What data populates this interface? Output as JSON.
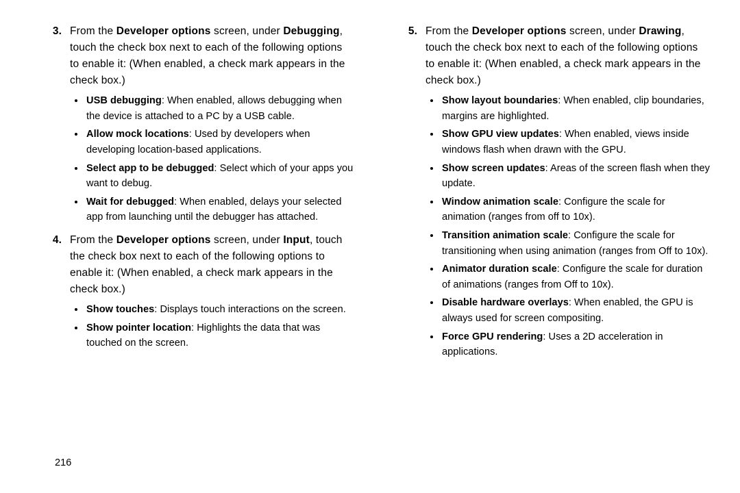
{
  "page_number": "216",
  "left": {
    "step3": {
      "num": "3.",
      "pre": "From the ",
      "b1": "Developer options",
      "mid": " screen, under ",
      "b2": "Debugging",
      "post": ", touch the check box next to each of the following options to enable it: (When enabled, a check mark appears in the check box.)",
      "items": [
        {
          "b": "USB debugging",
          "t": ": When enabled, allows debugging when the device is attached to a PC by a USB cable."
        },
        {
          "b": "Allow mock locations",
          "t": ": Used by developers when developing location-based applications."
        },
        {
          "b": "Select app to be debugged",
          "t": ": Select which of your apps you want to debug."
        },
        {
          "b": "Wait for debugged",
          "t": ": When enabled, delays your selected app from launching until the debugger has attached."
        }
      ]
    },
    "step4": {
      "num": "4.",
      "pre": "From the ",
      "b1": "Developer options",
      "mid": " screen, under ",
      "b2": "Input",
      "post": ", touch the check box next to each of the following options to enable it: (When enabled, a check mark appears in the check box.)",
      "items": [
        {
          "b": "Show touches",
          "t": ": Displays touch interactions on the screen."
        },
        {
          "b": "Show pointer location",
          "t": ": Highlights the data that was touched on the screen."
        }
      ]
    }
  },
  "right": {
    "step5": {
      "num": "5.",
      "pre": "From the ",
      "b1": "Developer options",
      "mid": " screen, under ",
      "b2": "Drawing",
      "post": ", touch the check box next to each of the following options to enable it: (When enabled, a check mark appears in the check box.)",
      "items": [
        {
          "b": "Show layout boundaries",
          "t": ": When enabled, clip boundaries, margins are highlighted."
        },
        {
          "b": "Show GPU view updates",
          "t": ": When enabled, views inside windows flash when drawn with the GPU."
        },
        {
          "b": "Show screen updates",
          "t": ": Areas of the screen flash when they update."
        },
        {
          "b": "Window animation scale",
          "t": ": Configure the scale for animation (ranges from off to 10x)."
        },
        {
          "b": "Transition animation scale",
          "t": ": Configure the scale for transitioning when using animation (ranges from Off to 10x)."
        },
        {
          "b": "Animator duration scale",
          "t": ": Configure the scale for duration of animations (ranges from Off to 10x)."
        },
        {
          "b": "Disable hardware overlays",
          "t": ": When enabled, the GPU is always used for screen compositing."
        },
        {
          "b": "Force GPU rendering",
          "t": ": Uses a 2D acceleration in applications."
        }
      ]
    }
  }
}
